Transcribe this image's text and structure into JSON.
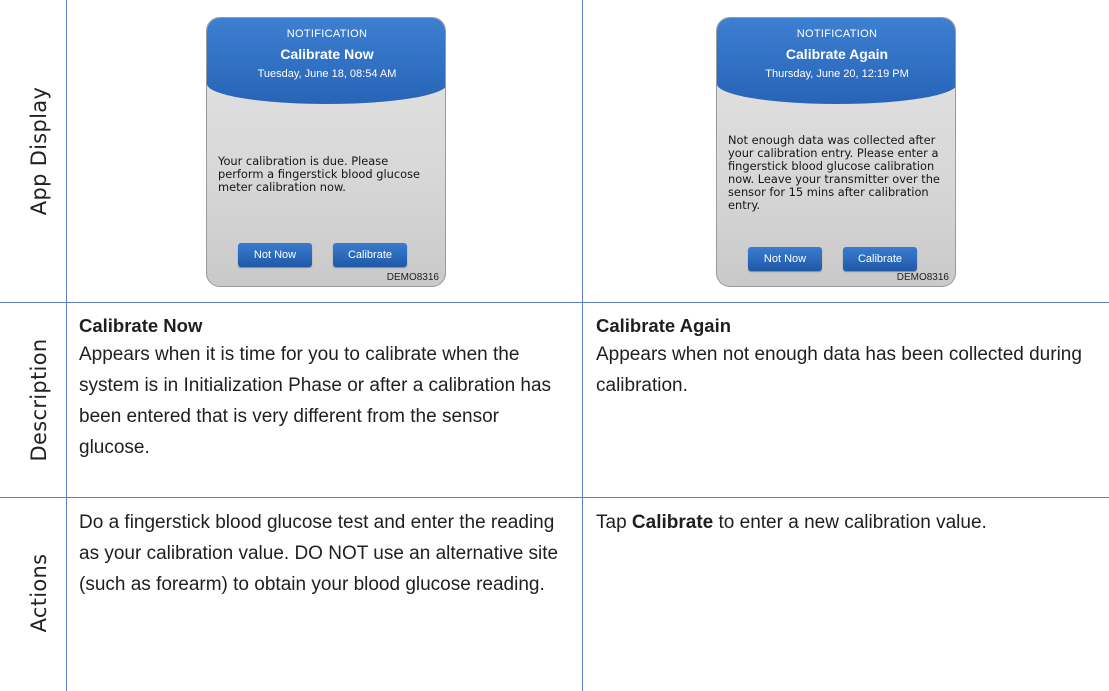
{
  "rows": {
    "app_display": "App Display",
    "description": "Description",
    "actions": "Actions"
  },
  "columns": [
    {
      "phone": {
        "kicker": "NOTIFICATION",
        "title": "Calibrate Now",
        "date": "Tuesday, June 18, 08:54 AM",
        "message": "Your calibration is due. Please perform a fingerstick blood glucose meter calibration now.",
        "button_left": "Not Now",
        "button_right": "Calibrate",
        "code": "DEMO8316"
      },
      "description": {
        "heading": "Calibrate Now",
        "text": "Appears when it is time for you to calibrate when the system is in Initialization Phase or after a calibration has been entered that is very different from the sensor glucose."
      },
      "actions": {
        "text": "Do a fingerstick blood glucose test and enter the reading as your calibration value. DO NOT use an alternative site (such as forearm) to obtain your blood glucose reading."
      }
    },
    {
      "phone": {
        "kicker": "NOTIFICATION",
        "title": "Calibrate Again",
        "date": "Thursday, June 20, 12:19 PM",
        "message": "Not enough data was collected after your calibration entry. Please enter a fingerstick blood glucose calibration now. Leave your transmitter over the sensor for 15 mins after calibration entry.",
        "button_left": "Not Now",
        "button_right": "Calibrate",
        "code": "DEMO8316"
      },
      "description": {
        "heading": "Calibrate Again",
        "text": "Appears when not enough data has been collected during calibration."
      },
      "actions": {
        "prefix": "Tap ",
        "bold": "Calibrate",
        "suffix": " to enter a new calibration value."
      }
    }
  ]
}
